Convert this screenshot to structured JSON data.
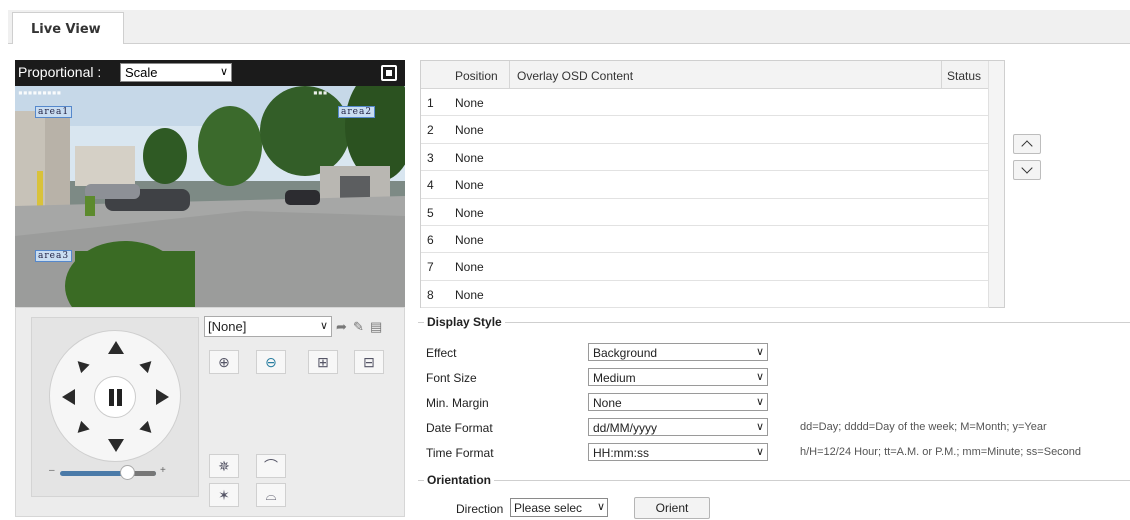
{
  "tabs": [
    {
      "label": "Live View"
    }
  ],
  "video": {
    "proportional_label": "Proportional :",
    "scale_value": "Scale",
    "osd_tags": [
      "area1",
      "area2",
      "area3"
    ]
  },
  "ptz": {
    "preset_value": "[None]",
    "speed": 0.7
  },
  "osd_table": {
    "headers": [
      "Position",
      "Overlay OSD Content",
      "Status"
    ],
    "rows": [
      {
        "num": "1",
        "position": "None"
      },
      {
        "num": "2",
        "position": "None"
      },
      {
        "num": "3",
        "position": "None"
      },
      {
        "num": "4",
        "position": "None"
      },
      {
        "num": "5",
        "position": "None"
      },
      {
        "num": "6",
        "position": "None"
      },
      {
        "num": "7",
        "position": "None"
      },
      {
        "num": "8",
        "position": "None"
      }
    ]
  },
  "display_style": {
    "legend": "Display Style",
    "effect": {
      "label": "Effect",
      "value": "Background"
    },
    "font_size": {
      "label": "Font Size",
      "value": "Medium"
    },
    "min_margin": {
      "label": "Min. Margin",
      "value": "None"
    },
    "date_format": {
      "label": "Date Format",
      "value": "dd/MM/yyyy",
      "hint": "dd=Day; dddd=Day of the week; M=Month; y=Year"
    },
    "time_format": {
      "label": "Time Format",
      "value": "HH:mm:ss",
      "hint": "h/H=12/24 Hour; tt=A.M. or P.M.; mm=Minute; ss=Second"
    }
  },
  "orientation": {
    "legend": "Orientation",
    "direction_label": "Direction",
    "direction_value": "Please selec",
    "orient_button": "Orient"
  },
  "icons": {
    "arrow": "→",
    "pencil": "✎",
    "trash": "Ὕ1"
  },
  "colors": {
    "toolbar": "#1b1b1b",
    "slider": "#4a7aa8",
    "osd_tag": "#c9ddf1"
  }
}
